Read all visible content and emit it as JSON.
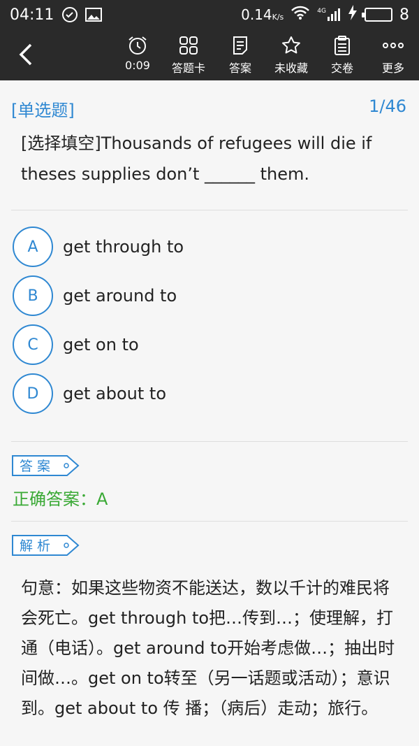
{
  "status_bar": {
    "time": "04:11",
    "speed": "0.14",
    "speed_unit": "K/s",
    "network": "4G",
    "battery": "8",
    "icons": [
      "check-circle-icon",
      "image-icon",
      "wifi-icon",
      "signal-icon",
      "charging-icon",
      "battery-icon"
    ]
  },
  "toolbar": {
    "timer_label": "0:09",
    "answer_card_label": "答题卡",
    "answer_label": "答案",
    "favorite_label": "未收藏",
    "submit_label": "交卷",
    "more_label": "更多"
  },
  "question": {
    "type": "[单选题]",
    "progress": "1/46",
    "text": "[选择填空]Thousands of refugees will die if theses supplies don’t ______ them."
  },
  "options": [
    {
      "letter": "A",
      "text": "get through to"
    },
    {
      "letter": "B",
      "text": "get around to"
    },
    {
      "letter": "C",
      "text": "get on to"
    },
    {
      "letter": "D",
      "text": "get about to"
    }
  ],
  "answer_section": {
    "tag": "答案",
    "correct": "正确答案：A"
  },
  "analysis_section": {
    "tag": "解析",
    "text": "句意：如果这些物资不能送达，数以千计的难民将会死亡。get through to把…传到…；使理解，打通（电话）。get around to开始考虑做…；抽出时间做…。get on to转至（另一话题或活动）；意识到。get about to 传 播；（病后）走动；旅行。"
  },
  "colors": {
    "accent": "#2f88d2",
    "correct": "#3aa935",
    "toolbar": "#2a2a2a"
  }
}
